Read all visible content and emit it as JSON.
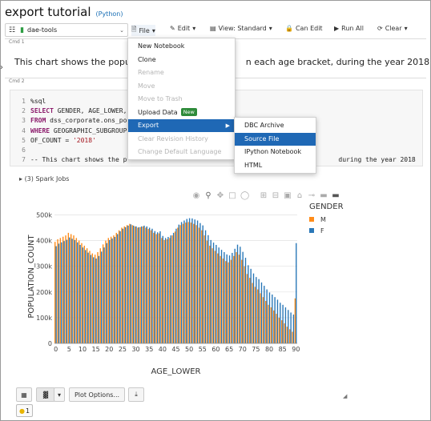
{
  "notebook": {
    "title": "export tutorial",
    "language": "(Python)"
  },
  "cluster": {
    "name": "dae-tools"
  },
  "toolbar": {
    "file": "File",
    "edit": "Edit",
    "view": "View: Standard",
    "can_edit": "Can Edit",
    "run_all": "Run All",
    "clear": "Clear"
  },
  "cells": {
    "cmd1_label": "Cmd 1",
    "cmd2_label": "Cmd 2",
    "markdown_left": "This chart shows the popula",
    "markdown_right": "n each age bracket, during the year 2018",
    "code_lines": [
      {
        "n": "1",
        "text": "%sql"
      },
      {
        "n": "2",
        "kw": "SELECT",
        "text": " GENDER, AGE_LOWER,"
      },
      {
        "n": "3",
        "kw": "FROM",
        "text": " dss_corporate.ons_po"
      },
      {
        "n": "4",
        "kw": "WHERE",
        "text": " GEOGRAPHIC_SUBGROUP"
      },
      {
        "n": "5",
        "text": "OF_COUNT = ",
        "str": "'2018'"
      },
      {
        "n": "6",
        "text": ""
      },
      {
        "n": "7",
        "comment_left": "-- This chart shows the p",
        "comment_right": "during the year 2018"
      }
    ],
    "spark_jobs": "(3) Spark Jobs"
  },
  "file_menu": {
    "items": [
      {
        "label": "New Notebook",
        "disabled": false
      },
      {
        "label": "Clone",
        "disabled": false
      },
      {
        "label": "Rename",
        "disabled": true
      },
      {
        "label": "Move",
        "disabled": true
      },
      {
        "label": "Move to Trash",
        "disabled": true
      },
      {
        "label": "Upload Data",
        "disabled": false,
        "badge": "New"
      },
      {
        "label": "Export",
        "disabled": false,
        "highlighted": true,
        "submenu": true
      },
      {
        "label": "Clear Revision History",
        "disabled": true
      },
      {
        "label": "Change Default Language",
        "disabled": true
      }
    ]
  },
  "export_menu": {
    "items": [
      {
        "label": "DBC Archive",
        "highlighted": false
      },
      {
        "label": "Source File",
        "highlighted": true
      },
      {
        "label": "IPython Notebook",
        "highlighted": false
      },
      {
        "label": "HTML",
        "highlighted": false
      }
    ]
  },
  "bottom_toolbar": {
    "plot_options": "Plot Options...",
    "bulb_count": "1"
  },
  "colors": {
    "M": "#ff8c1a",
    "F": "#2a78b8",
    "accent": "#1f68b5"
  },
  "chart_data": {
    "type": "bar",
    "xlabel": "AGE_LOWER",
    "ylabel": "POPULATION_COUNT",
    "legend_title": "GENDER",
    "legend_position": "top-right",
    "x": [
      0,
      1,
      2,
      3,
      4,
      5,
      6,
      7,
      8,
      9,
      10,
      11,
      12,
      13,
      14,
      15,
      16,
      17,
      18,
      19,
      20,
      21,
      22,
      23,
      24,
      25,
      26,
      27,
      28,
      29,
      30,
      31,
      32,
      33,
      34,
      35,
      36,
      37,
      38,
      39,
      40,
      41,
      42,
      43,
      44,
      45,
      46,
      47,
      48,
      49,
      50,
      51,
      52,
      53,
      54,
      55,
      56,
      57,
      58,
      59,
      60,
      61,
      62,
      63,
      64,
      65,
      66,
      67,
      68,
      69,
      70,
      71,
      72,
      73,
      74,
      75,
      76,
      77,
      78,
      79,
      80,
      81,
      82,
      83,
      84,
      85,
      86,
      87,
      88,
      89,
      90
    ],
    "x_ticks": [
      0,
      5,
      10,
      15,
      20,
      25,
      30,
      35,
      40,
      45,
      50,
      55,
      60,
      65,
      70,
      75,
      80,
      85,
      90
    ],
    "y_ticks": [
      0,
      100000,
      200000,
      300000,
      400000,
      500000
    ],
    "y_tick_labels": [
      "0",
      "100k",
      "200k",
      "300k",
      "400k",
      "500k"
    ],
    "ylim": [
      0,
      520000
    ],
    "series": [
      {
        "name": "M",
        "values": [
          395000,
          405000,
          410000,
          415000,
          420000,
          430000,
          425000,
          420000,
          410000,
          400000,
          390000,
          380000,
          370000,
          360000,
          350000,
          345000,
          355000,
          370000,
          385000,
          400000,
          410000,
          415000,
          420000,
          430000,
          440000,
          450000,
          455000,
          460000,
          465000,
          460000,
          455000,
          450000,
          452000,
          455000,
          450000,
          445000,
          440000,
          430000,
          425000,
          428000,
          410000,
          402000,
          405000,
          410000,
          420000,
          435000,
          450000,
          460000,
          465000,
          470000,
          472000,
          470000,
          465000,
          460000,
          450000,
          440000,
          420000,
          400000,
          380000,
          370000,
          360000,
          350000,
          340000,
          330000,
          320000,
          315000,
          325000,
          340000,
          355000,
          345000,
          325000,
          300000,
          270000,
          255000,
          235000,
          220000,
          210000,
          195000,
          180000,
          165000,
          150000,
          140000,
          128000,
          115000,
          100000,
          90000,
          78000,
          65000,
          55000,
          45000,
          175000
        ]
      },
      {
        "name": "F",
        "values": [
          378000,
          388000,
          393000,
          398000,
          403000,
          412000,
          407000,
          402000,
          393000,
          383000,
          373000,
          363000,
          353000,
          344000,
          335000,
          330000,
          340000,
          357000,
          373000,
          390000,
          402000,
          408000,
          414000,
          425000,
          436000,
          446000,
          452000,
          458000,
          463000,
          458000,
          455000,
          452000,
          455000,
          458000,
          455000,
          450000,
          446000,
          437000,
          432000,
          436000,
          418000,
          410000,
          414000,
          420000,
          430000,
          446000,
          462000,
          472000,
          478000,
          484000,
          487000,
          486000,
          482000,
          478000,
          468000,
          459000,
          440000,
          421000,
          402000,
          392000,
          383000,
          373000,
          364000,
          355000,
          346000,
          342000,
          352000,
          368000,
          384000,
          376000,
          356000,
          333000,
          304000,
          290000,
          272000,
          258000,
          250000,
          237000,
          224000,
          210000,
          198000,
          190000,
          180000,
          170000,
          158000,
          150000,
          140000,
          130000,
          120000,
          112000,
          390000
        ]
      }
    ]
  }
}
